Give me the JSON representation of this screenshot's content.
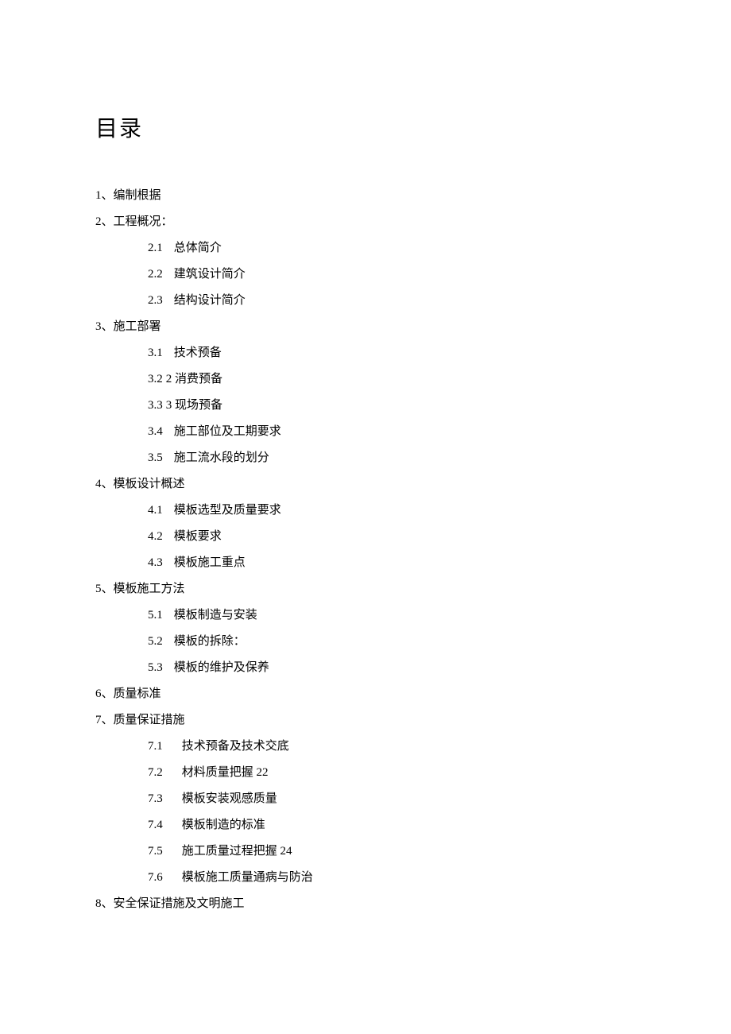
{
  "title": "目录",
  "toc": [
    {
      "level": 1,
      "num": "1、",
      "text": "编制根据"
    },
    {
      "level": 1,
      "num": "2、",
      "text": "工程概况："
    },
    {
      "level": 2,
      "num": "2.1",
      "text": "总体简介"
    },
    {
      "level": 2,
      "num": "2.2",
      "text": "建筑设计简介"
    },
    {
      "level": 2,
      "num": "2.3",
      "text": "结构设计简介"
    },
    {
      "level": 1,
      "num": "3、",
      "text": "施工部署"
    },
    {
      "level": 2,
      "num": "3.1",
      "text": "技术预备"
    },
    {
      "level": 2,
      "num": "3.2",
      "text": "2 消费预备",
      "tight": true
    },
    {
      "level": 2,
      "num": "3.3",
      "text": "3 现场预备",
      "tight": true
    },
    {
      "level": 2,
      "num": "3.4",
      "text": "施工部位及工期要求"
    },
    {
      "level": 2,
      "num": "3.5",
      "text": "施工流水段的划分"
    },
    {
      "level": 1,
      "num": "4、",
      "text": "模板设计概述"
    },
    {
      "level": 2,
      "num": "4.1",
      "text": "模板选型及质量要求"
    },
    {
      "level": 2,
      "num": "4.2",
      "text": "模板要求"
    },
    {
      "level": 2,
      "num": "4.3",
      "text": "模板施工重点"
    },
    {
      "level": 1,
      "num": "5、",
      "text": "模板施工方法"
    },
    {
      "level": 2,
      "num": "5.1",
      "text": "模板制造与安装"
    },
    {
      "level": 2,
      "num": "5.2",
      "text": "模板的拆除："
    },
    {
      "level": 2,
      "num": "5.3",
      "text": "模板的维护及保养"
    },
    {
      "level": 1,
      "num": "6、",
      "text": "质量标准"
    },
    {
      "level": 1,
      "num": "7、",
      "text": "质量保证措施"
    },
    {
      "level": 2,
      "num": "7.1",
      "text": "技术预备及技术交底",
      "wide": true
    },
    {
      "level": 2,
      "num": "7.2",
      "text": "材料质量把握 22",
      "wide": true
    },
    {
      "level": 2,
      "num": "7.3",
      "text": "模板安装观感质量",
      "wide": true
    },
    {
      "level": 2,
      "num": "7.4",
      "text": "模板制造的标准",
      "wide": true
    },
    {
      "level": 2,
      "num": "7.5",
      "text": "施工质量过程把握 24",
      "wide": true
    },
    {
      "level": 2,
      "num": "7.6",
      "text": "模板施工质量通病与防治",
      "wide": true
    },
    {
      "level": 1,
      "num": "8、",
      "text": "安全保证措施及文明施工"
    }
  ]
}
